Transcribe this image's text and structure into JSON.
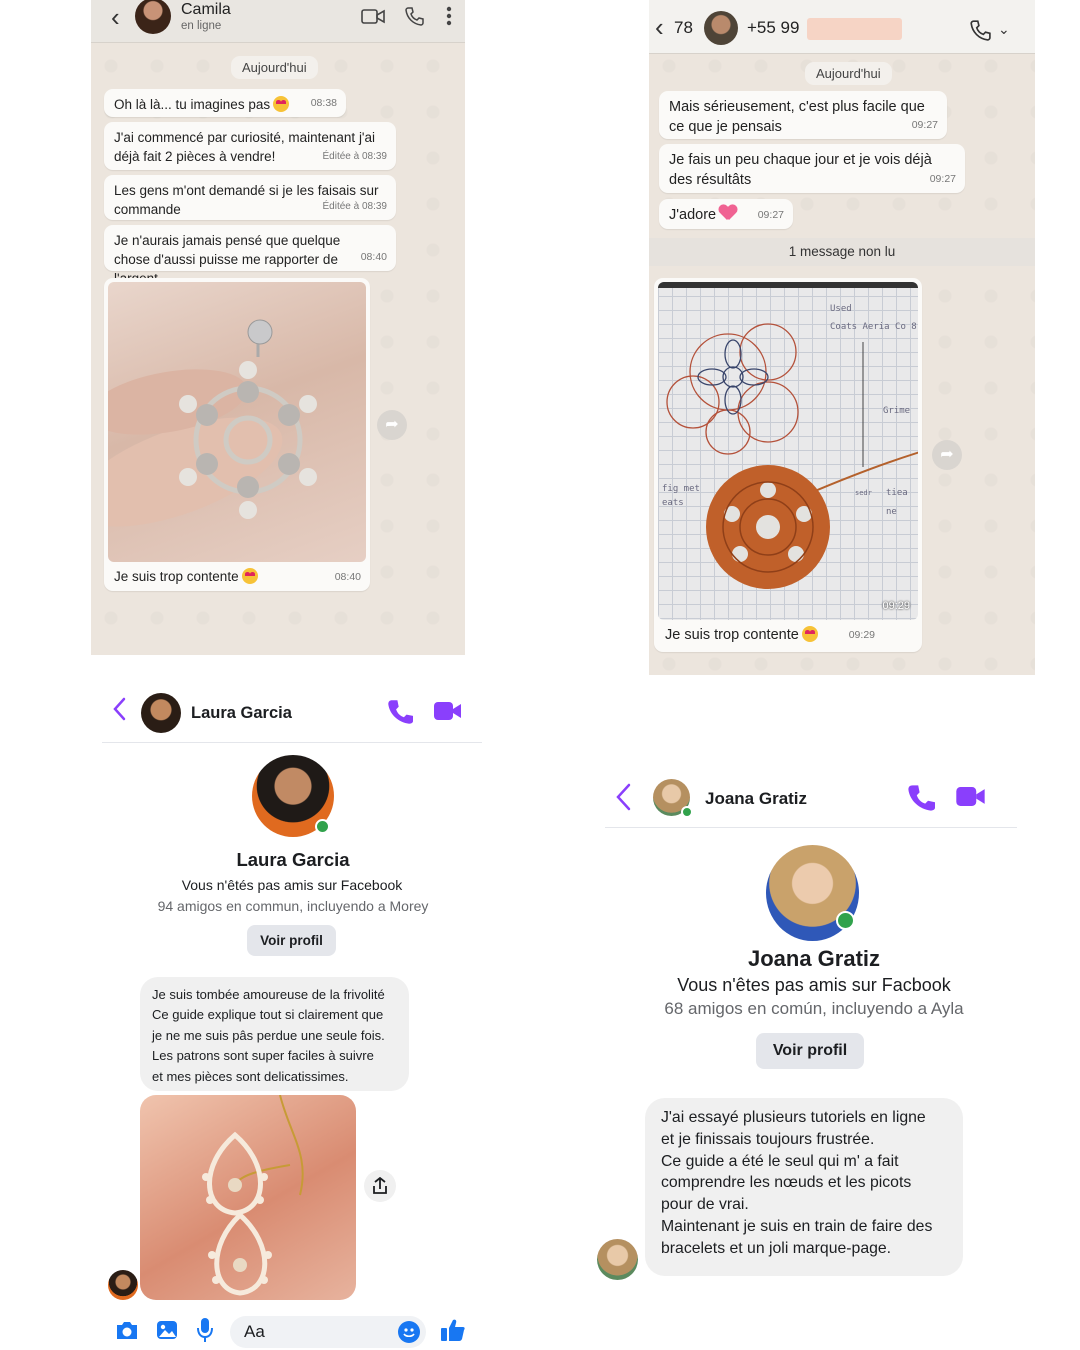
{
  "panel1": {
    "contact_name": "Camila",
    "contact_status": "en ligne",
    "date_label": "Aujourd'hui",
    "messages": [
      {
        "text": "Oh là là... tu imagines pas",
        "time": "08:38"
      },
      {
        "text": "J'ai commencé par curiosité, maintenant j'ai déjà fait 2 pièces à vendre!",
        "edited": "Éditée à 08:39"
      },
      {
        "text": "Les gens m'ont demandé si je les faisais sur commande",
        "edited": "Éditée à 08:39"
      },
      {
        "text": "Je n'aurais jamais pensé que quelque chose d'aussi puisse me rapporter de l'argent",
        "time": "08:40"
      }
    ],
    "photo_caption": "Je suis trop contente",
    "photo_time": "08:40"
  },
  "panel2": {
    "back_count": "78",
    "phone_prefix": "+55 99",
    "date_label": "Aujourd'hui",
    "messages": [
      {
        "text": "Mais sérieusement, c'est plus facile que ce que je pensais",
        "time": "09:27"
      },
      {
        "text": "Je fais un peu chaque jour et je vois déjà des résultâts",
        "time": "09:27"
      },
      {
        "text": "J'adore",
        "time": "09:27"
      }
    ],
    "unread_label": "1 message non lu",
    "photo_time": "09:29",
    "photo_caption": "Je suis trop contente",
    "caption_time": "09:29",
    "sketch_notes": [
      "Used",
      "Coats Aeria Co 8",
      "Grime",
      "fig met",
      "eats",
      "tiea ne",
      "sedr"
    ]
  },
  "panel3": {
    "header_name": "Laura Garcia",
    "profile_name": "Laura Garcia",
    "not_friends": "Vous n'êtés pas amis sur Facebook",
    "mutual": "94 amigos en commun, incluyendo a Morey",
    "view_profile": "Voir profil",
    "message_lines": [
      "Je suis tombée amoureuse de la frivolité",
      "Ce guide explique tout si clairement que",
      "je ne me suis pâs perdue une seule fois.",
      "Les patrons sont super faciles à suivre",
      "et mes pièces sont delicatissimes."
    ],
    "composer_placeholder": "Aa"
  },
  "panel4": {
    "header_name": "Joana Gratiz",
    "profile_name": "Joana Gratiz",
    "not_friends": "Vous n'êtes pas amis sur Facbook",
    "mutual": "68 amigos en común, incluyendo a Ayla",
    "view_profile": "Voir profil",
    "message_lines": [
      "J'ai essayé plusieurs tutoriels en ligne",
      "et je finissais toujours frustrée.",
      "Ce guide a été le seul qui m' a fait",
      "comprendre les nœuds et les picots",
      "pour de vrai.",
      "Maintenant je suis en train de faire des",
      "bracelets et un joli marque-page."
    ]
  },
  "colors": {
    "messenger_accent": "#8a3ffc",
    "whatsapp_bg": "#ece5dd",
    "online_dot": "#31a24c"
  }
}
